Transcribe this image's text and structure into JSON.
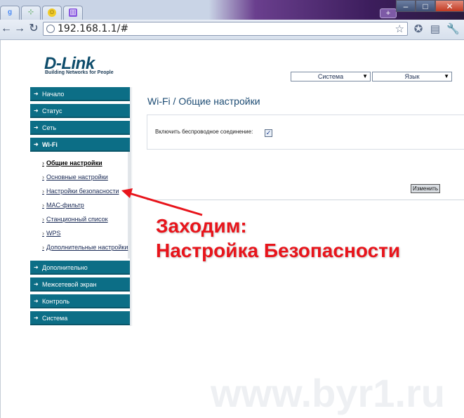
{
  "browser": {
    "tabs": [
      {
        "icon": "google-icon",
        "color": "#4a8af4"
      },
      {
        "icon": "router-icon",
        "color": "#3a9a3a"
      },
      {
        "icon": "smiley-icon",
        "color": "#e6b800"
      },
      {
        "icon": "chart-icon",
        "color": "#7a4ad0"
      }
    ],
    "new_tab": "+",
    "url": "192.168.1.1/#",
    "window_controls": {
      "minimize": "–",
      "maximize": "□",
      "close": "✕"
    }
  },
  "header": {
    "logo": "D-Link",
    "tagline": "Building Networks for People",
    "system_select": "Система",
    "language_select": "Язык"
  },
  "sidebar": {
    "items_top": [
      {
        "label": "Начало"
      },
      {
        "label": "Статус"
      },
      {
        "label": "Сеть"
      },
      {
        "label": "Wi-Fi"
      }
    ],
    "sub_items": [
      {
        "label": "Общие настройки"
      },
      {
        "label": "Основные настройки"
      },
      {
        "label": "Настройки безопасности"
      },
      {
        "label": "MAC-фильтр"
      },
      {
        "label": "Станционный список"
      },
      {
        "label": "WPS"
      },
      {
        "label": "Дополнительные настройки"
      }
    ],
    "items_bottom": [
      {
        "label": "Дополнительно"
      },
      {
        "label": "Межсетевой экран"
      },
      {
        "label": "Контроль"
      },
      {
        "label": "Система"
      }
    ]
  },
  "main": {
    "title": "Wi-Fi /  Общие настройки",
    "enable_wireless_label": "Включить беспроводное соединение:",
    "enable_wireless_checked": true,
    "change_button": "Изменить"
  },
  "annotation": {
    "line1": "Заходим:",
    "line2": "Настройка Безопасности",
    "color": "#e8141b"
  },
  "watermark": "www.byr1.ru"
}
